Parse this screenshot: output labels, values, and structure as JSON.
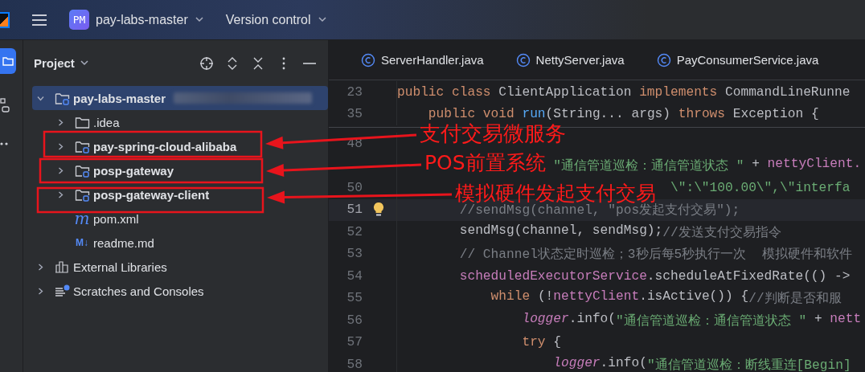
{
  "top_bar": {
    "project_badge": "PM",
    "project": "pay-labs-master",
    "vcs": "Version control"
  },
  "tool_window": {
    "title": "Project"
  },
  "tree": [
    {
      "label": "pay-labs-master",
      "kind": "module",
      "selected": true,
      "expanded": true,
      "children": [
        {
          "label": ".idea",
          "kind": "folder",
          "selected": false,
          "expanded": false
        },
        {
          "label": "pay-spring-cloud-alibaba",
          "kind": "module",
          "selected": false,
          "expanded": false
        },
        {
          "label": "posp-gateway",
          "kind": "module",
          "selected": false,
          "expanded": false
        },
        {
          "label": "posp-gateway-client",
          "kind": "module",
          "selected": false,
          "expanded": false
        },
        {
          "label": "pom.xml",
          "kind": "maven",
          "icon_text": "m",
          "selected": false
        },
        {
          "label": "readme.md",
          "kind": "markdown",
          "icon_text": "M↓",
          "selected": false
        }
      ]
    },
    {
      "label": "External Libraries",
      "kind": "libraries",
      "selected": false,
      "expanded": false
    },
    {
      "label": "Scratches and Consoles",
      "kind": "scratches",
      "selected": false,
      "expanded": false
    }
  ],
  "tabs": [
    {
      "label": "ServerHandler.java",
      "selected": false
    },
    {
      "label": "NettyServer.java",
      "selected": false
    },
    {
      "label": "PayConsumerService.java",
      "selected": false
    }
  ],
  "editor": {
    "sticky_lines": [
      {
        "number": "23",
        "current": false,
        "tokens": [
          {
            "text": "public class ",
            "kind": "keyword"
          },
          {
            "text": "ClientApplication ",
            "kind": "plain"
          },
          {
            "text": "implements ",
            "kind": "keyword"
          },
          {
            "text": "CommandLineRunne",
            "kind": "plain"
          }
        ]
      },
      {
        "number": "35",
        "current": false,
        "tokens": [
          {
            "text": "    public void ",
            "kind": "keyword"
          },
          {
            "text": "run",
            "kind": "declaration"
          },
          {
            "text": "(String... args) ",
            "kind": "plain"
          },
          {
            "text": "throws ",
            "kind": "keyword"
          },
          {
            "text": "Exception {",
            "kind": "plain"
          }
        ]
      }
    ],
    "lines": [
      {
        "number": "48",
        "current": false
      },
      {
        "current": false,
        "tokens": [
          {
            "text": "                    \"通信管道巡检：通信管道状态 \"",
            "kind": "string"
          },
          {
            "text": " + ",
            "kind": "plain"
          },
          {
            "text": "nettyClient.",
            "kind": "field"
          }
        ]
      },
      {
        "number": "50",
        "current": false,
        "tokens": [
          {
            "text": "                                   \\\":\\\"100.00\\\",\\\"interfa",
            "kind": "string"
          }
        ]
      },
      {
        "number": "51",
        "current": true,
        "bulb": true,
        "tokens": [
          {
            "text": "        //sendMsg(channel, \"pos发起支付交易\");",
            "kind": "comment"
          }
        ]
      },
      {
        "number": "52",
        "current": false,
        "tokens": [
          {
            "text": "        sendMsg(channel, sendMsg);",
            "kind": "plain"
          },
          {
            "text": "//发送支付交易指令",
            "kind": "comment"
          }
        ]
      },
      {
        "number": "53",
        "current": false,
        "tokens": [
          {
            "text": "        // Channel状态定时巡检；3秒后每5秒执行一次  模拟硬件和软件",
            "kind": "comment"
          }
        ]
      },
      {
        "number": "54",
        "current": false,
        "tokens": [
          {
            "text": "        scheduledExecutorService",
            "kind": "field"
          },
          {
            "text": ".scheduleAtFixedRate(() ->",
            "kind": "plain"
          }
        ]
      },
      {
        "number": "55",
        "current": false,
        "tokens": [
          {
            "text": "            while ",
            "kind": "keyword"
          },
          {
            "text": "(!",
            "kind": "plain"
          },
          {
            "text": "nettyClient",
            "kind": "field"
          },
          {
            "text": ".isActive()) {",
            "kind": "plain"
          },
          {
            "text": "//判断是否和服",
            "kind": "comment"
          }
        ]
      },
      {
        "number": "56",
        "current": false,
        "tokens": [
          {
            "text": "                logger",
            "kind": "static_field"
          },
          {
            "text": ".info(",
            "kind": "plain"
          },
          {
            "text": "\"通信管道巡检：通信管道状态 \"",
            "kind": "string"
          },
          {
            "text": " + ",
            "kind": "plain"
          },
          {
            "text": "nett",
            "kind": "field"
          }
        ]
      },
      {
        "number": "57",
        "current": false,
        "tokens": [
          {
            "text": "                try ",
            "kind": "keyword"
          },
          {
            "text": "{",
            "kind": "plain"
          }
        ]
      },
      {
        "number": "58",
        "current": false,
        "tokens": [
          {
            "text": "                    logger",
            "kind": "static_field"
          },
          {
            "text": ".info(",
            "kind": "plain"
          },
          {
            "text": "\"通信管道巡检：断线重连[Begin]",
            "kind": "string"
          }
        ]
      }
    ]
  },
  "annotations": [
    {
      "text": "支付交易微服务"
    },
    {
      "text": "POS前置系统"
    },
    {
      "text": "模拟硬件发起支付交易"
    }
  ]
}
